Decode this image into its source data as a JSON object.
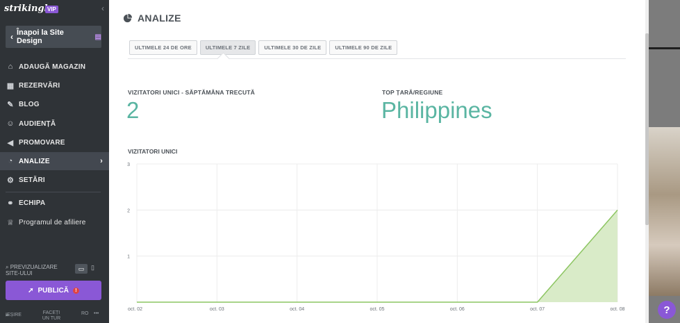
{
  "sidebar": {
    "brand": "strikingly",
    "vip": "VIP",
    "back_button": "Înapoi la Site Design",
    "items": [
      {
        "label": "ADAUGĂ MAGAZIN"
      },
      {
        "label": "REZERVĂRI"
      },
      {
        "label": "BLOG"
      },
      {
        "label": "AUDIENȚĂ"
      },
      {
        "label": "PROMOVARE"
      },
      {
        "label": "ANALIZE"
      },
      {
        "label": "SETĂRI"
      },
      {
        "label": "ECHIPA"
      },
      {
        "label": "Programul de afiliere"
      }
    ],
    "preview_label": "PREVIZUALIZARE SITE-ULUI",
    "publish_label": "PUBLICĂ",
    "footer": {
      "exit": "IEȘIRE",
      "tour": "FACEȚI UN TUR",
      "lang": "RO",
      "more": "•••"
    }
  },
  "main": {
    "title": "ANALIZE",
    "tabs": [
      "ULTIMELE 24 DE ORE",
      "ULTIMELE 7 ZILE",
      "ULTIMELE 30 DE ZILE",
      "ULTIMELE 90 DE ZILE"
    ],
    "active_tab": "ULTIMELE 7 ZILE",
    "visitors_label": "VIZITATORI UNICI - SĂPTĂMÂNA TRECUTĂ",
    "visitors_value": "2",
    "top_label": "TOP ȚARĂ/REGIUNE",
    "top_value": "Philippines",
    "chart_title": "VIZITATORI UNICI"
  },
  "chart_data": {
    "type": "area",
    "title": "VIZITATORI UNICI",
    "x": [
      "oct. 02",
      "oct. 03",
      "oct. 04",
      "oct. 05",
      "oct. 06",
      "oct. 07",
      "oct. 08"
    ],
    "values": [
      0,
      0,
      0,
      0,
      0,
      0,
      2
    ],
    "ylim": [
      0,
      3
    ],
    "yticks": [
      1,
      2,
      3
    ],
    "grid": true,
    "color": "#8cc561"
  },
  "colors": {
    "sidebar_bg": "#2f3337",
    "accent_purple": "#8a58d6",
    "stat_teal": "#5ab5a2"
  },
  "help": "?"
}
